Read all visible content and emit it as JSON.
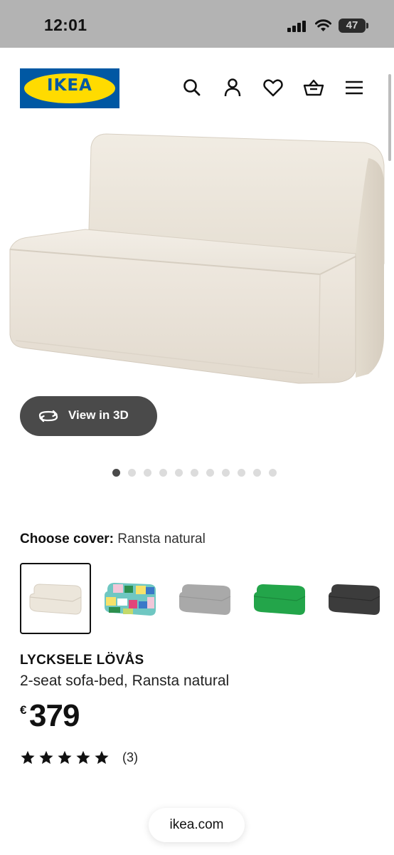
{
  "status_bar": {
    "time": "12:01",
    "battery": "47",
    "icons": [
      "signal-icon",
      "wifi-icon",
      "battery-icon"
    ]
  },
  "header": {
    "logo_text": "IKEA",
    "icons": [
      "search-icon",
      "account-icon",
      "heart-icon",
      "basket-icon",
      "menu-icon"
    ],
    "brand_colors": {
      "blue": "#0058a3",
      "yellow": "#ffdb00"
    }
  },
  "gallery": {
    "view_3d_label": "View in 3D",
    "image_count": 11,
    "active_index": 0
  },
  "cover": {
    "label": "Choose cover:",
    "selected": "Ransta natural",
    "options": [
      {
        "name": "Ransta natural",
        "color": "#ece6db",
        "selected": true
      },
      {
        "name": "multicolour patchwork",
        "color": "#6fc7c2",
        "selected": false
      },
      {
        "name": "light grey",
        "color": "#a9a9a9",
        "selected": false
      },
      {
        "name": "green",
        "color": "#23a54a",
        "selected": false
      },
      {
        "name": "dark grey",
        "color": "#3c3c3c",
        "selected": false
      }
    ]
  },
  "product": {
    "name": "LYCKSELE LÖVÅS",
    "description": "2-seat sofa-bed, Ransta natural",
    "currency": "€",
    "price": "379",
    "rating": 5,
    "rating_count": "(3)"
  },
  "browser": {
    "url": "ikea.com"
  }
}
